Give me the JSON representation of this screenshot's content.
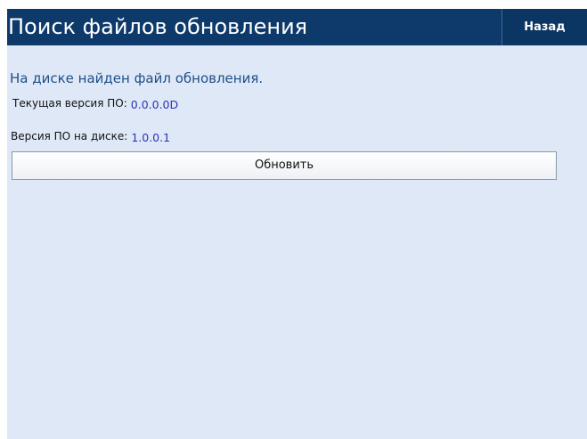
{
  "header": {
    "title": "Поиск файлов обновления",
    "back_label": "Назад"
  },
  "main": {
    "message": "На диске найден файл обновления.",
    "current_version": {
      "label": "Текущая версия ПО:",
      "value": "0.0.0.0D"
    },
    "disk_version": {
      "label": "Версия ПО на диске:",
      "value": "1.0.0.1"
    },
    "update_label": "Обновить"
  },
  "colors": {
    "header_bg": "#0d3a6a",
    "content_bg": "#dfe8f6",
    "message_text": "#1f4f8a",
    "version_value": "#2a35b8"
  }
}
